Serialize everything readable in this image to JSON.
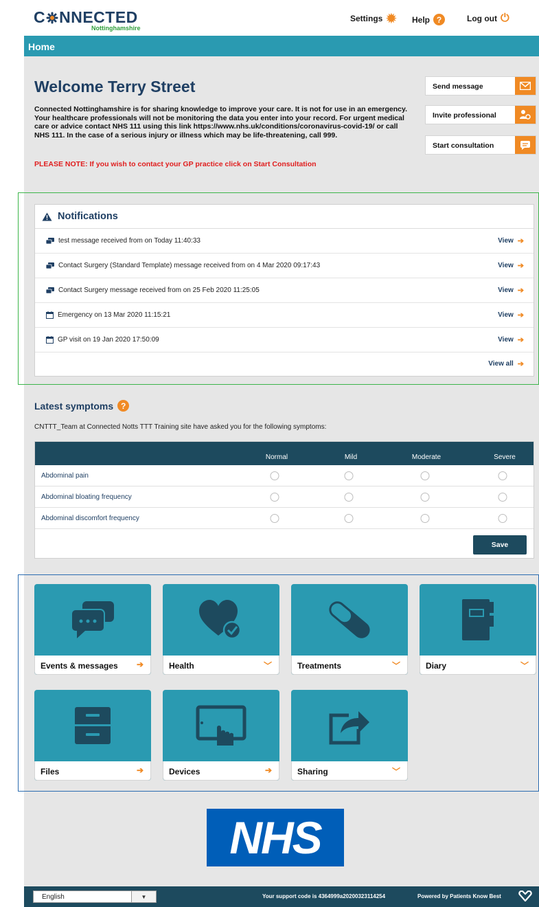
{
  "header": {
    "logo_main_a": "C",
    "logo_main_b": "NNECTED",
    "logo_sub": "Nottinghamshire",
    "settings": "Settings",
    "help": "Help",
    "help_glyph": "?",
    "logout": "Log out"
  },
  "nav": {
    "title": "Home"
  },
  "welcome": {
    "title": "Welcome Terry Street",
    "body": "Connected Nottinghamshire is for sharing knowledge to improve your care. It is not for use in an emergency. Your healthcare professionals will not be monitoring the data you enter into your record. For urgent medical care or advice contact NHS 111 using this link https://www.nhs.uk/conditions/coronavirus-covid-19/ or call NHS 111. In the case of a serious injury or illness which may be life-threatening, call 999.",
    "note": "PLEASE NOTE: If you wish to contact your GP practice click on Start Consultation"
  },
  "actions": {
    "send_message": "Send message",
    "invite_professional": "Invite professional",
    "start_consultation": "Start consultation"
  },
  "notifications": {
    "title": "Notifications",
    "items": [
      {
        "icon": "message-icon",
        "text": "test message received from on Today 11:40:33",
        "link": "View"
      },
      {
        "icon": "message-icon",
        "text": "Contact Surgery (Standard Template) message received from on 4 Mar 2020 09:17:43",
        "link": "View"
      },
      {
        "icon": "message-icon",
        "text": "Contact Surgery message received from on 25 Feb 2020 11:25:05",
        "link": "View"
      },
      {
        "icon": "calendar-icon",
        "text": "Emergency on 13 Mar 2020 11:15:21",
        "link": "View"
      },
      {
        "icon": "calendar-icon",
        "text": "GP visit on 19 Jan 2020 17:50:09",
        "link": "View"
      }
    ],
    "view_all": "View all"
  },
  "symptoms": {
    "title": "Latest symptoms",
    "help_glyph": "?",
    "description": "CNTTT_Team at Connected Notts TTT Training site have asked you for the following symptoms:",
    "columns": [
      "Normal",
      "Mild",
      "Moderate",
      "Severe"
    ],
    "rows": [
      "Abdominal pain",
      "Abdominal bloating frequency",
      "Abdominal discomfort frequency"
    ],
    "save": "Save"
  },
  "tiles": [
    {
      "label": "Events & messages",
      "icon": "chat-bubbles-icon",
      "action": "arrow"
    },
    {
      "label": "Health",
      "icon": "heart-check-icon",
      "action": "chevron"
    },
    {
      "label": "Treatments",
      "icon": "pill-icon",
      "action": "chevron"
    },
    {
      "label": "Diary",
      "icon": "notebook-icon",
      "action": "chevron"
    },
    {
      "label": "Files",
      "icon": "file-cabinet-icon",
      "action": "arrow"
    },
    {
      "label": "Devices",
      "icon": "tablet-touch-icon",
      "action": "arrow"
    },
    {
      "label": "Sharing",
      "icon": "share-icon",
      "action": "chevron"
    }
  ],
  "nhs_logo": "NHS",
  "footer": {
    "language": "English",
    "support_code": "Your support code is 4364999a20200323114254",
    "powered_by": "Powered by Patients Know Best"
  },
  "colors": {
    "brand_navy": "#1f3f63",
    "teal": "#2a9ab1",
    "accent_orange": "#f08a24",
    "dark_teal": "#1d4a5e",
    "alert_red": "#e01e1e",
    "nhs_blue": "#005eb8"
  }
}
